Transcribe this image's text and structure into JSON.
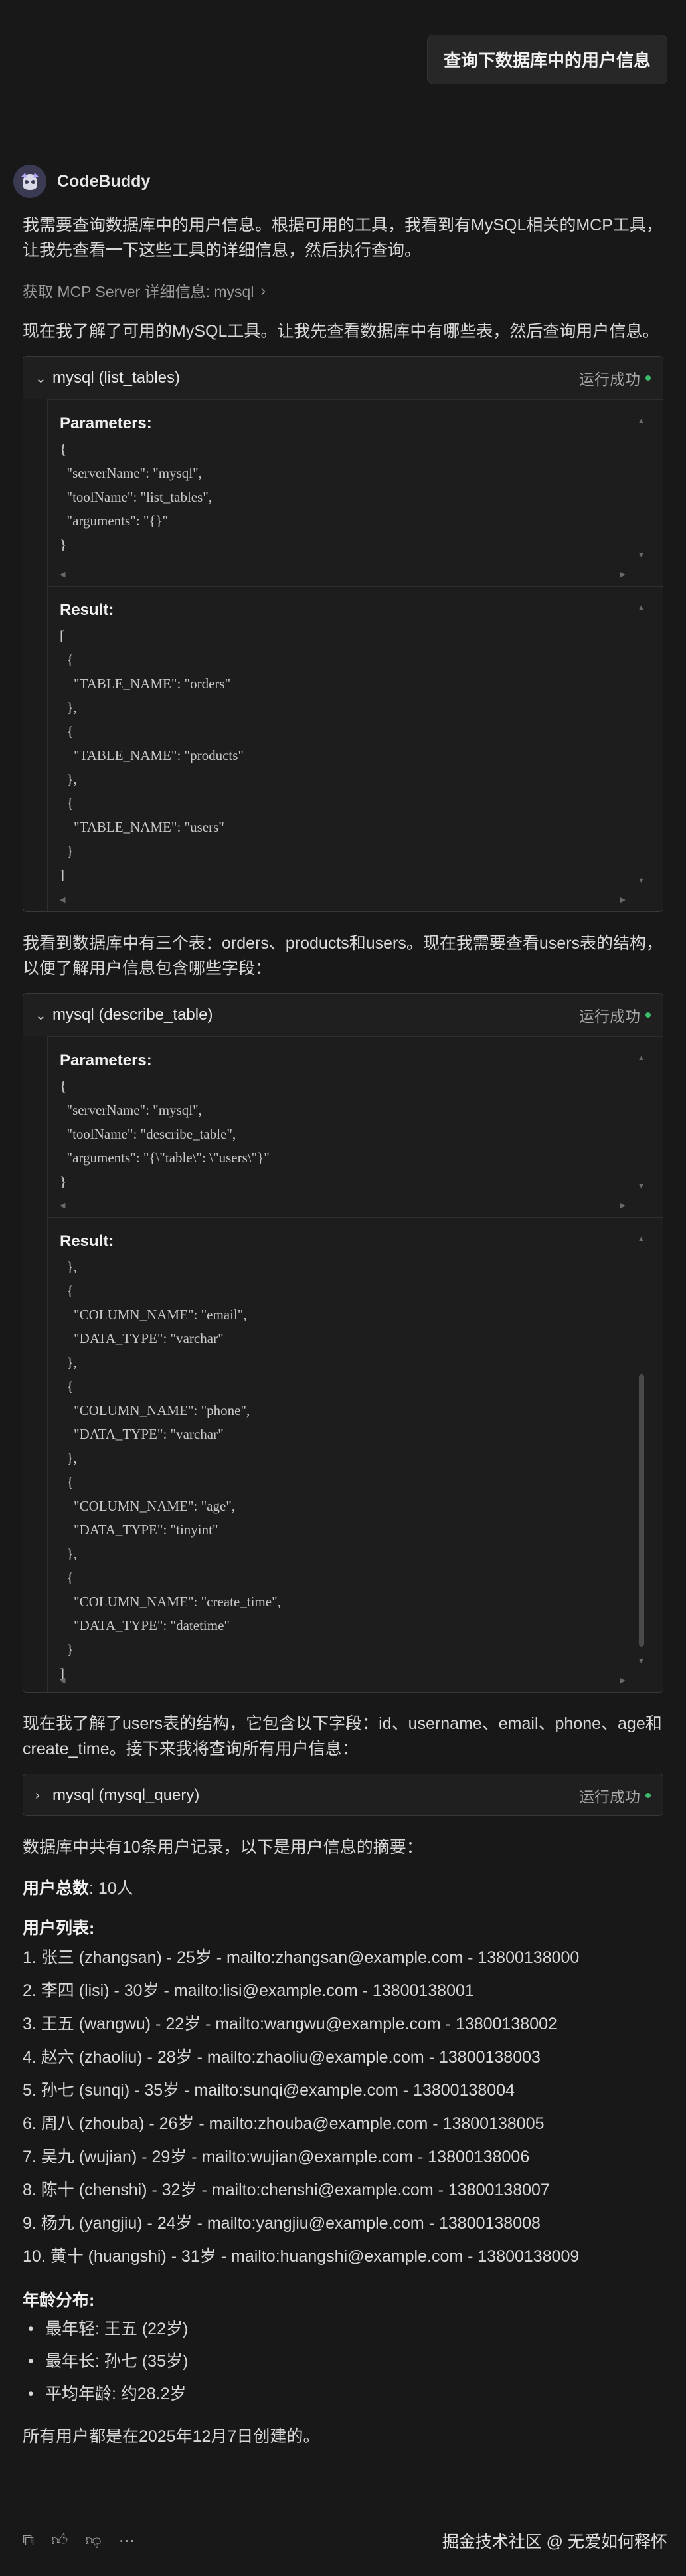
{
  "user_message": "查询下数据库中的用户信息",
  "agent": {
    "name": "CodeBuddy"
  },
  "intro": "我需要查询数据库中的用户信息。根据可用的工具，我看到有MySQL相关的MCP工具，让我先查看一下这些工具的详细信息，然后执行查询。",
  "mcp_link": "获取 MCP Server 详细信息: mysql",
  "para_after_mcp": "现在我了解了可用的MySQL工具。让我先查看数据库中有哪些表，然后查询用户信息。",
  "tool1": {
    "title": "mysql (list_tables)",
    "status": "运行成功",
    "params_label": "Parameters:",
    "params_code": "{\n  \"serverName\": \"mysql\",\n  \"toolName\": \"list_tables\",\n  \"arguments\": \"{}\"\n}",
    "result_label": "Result:",
    "result_code": "[\n  {\n    \"TABLE_NAME\": \"orders\"\n  },\n  {\n    \"TABLE_NAME\": \"products\"\n  },\n  {\n    \"TABLE_NAME\": \"users\"\n  }\n]"
  },
  "para_tables": "我看到数据库中有三个表：orders、products和users。现在我需要查看users表的结构，以便了解用户信息包含哪些字段：",
  "tool2": {
    "title": "mysql (describe_table)",
    "status": "运行成功",
    "params_label": "Parameters:",
    "params_code": "{\n  \"serverName\": \"mysql\",\n  \"toolName\": \"describe_table\",\n  \"arguments\": \"{\\\"table\\\": \\\"users\\\"}\"\n}",
    "result_label": "Result:",
    "result_code": "  },\n  {\n    \"COLUMN_NAME\": \"email\",\n    \"DATA_TYPE\": \"varchar\"\n  },\n  {\n    \"COLUMN_NAME\": \"phone\",\n    \"DATA_TYPE\": \"varchar\"\n  },\n  {\n    \"COLUMN_NAME\": \"age\",\n    \"DATA_TYPE\": \"tinyint\"\n  },\n  {\n    \"COLUMN_NAME\": \"create_time\",\n    \"DATA_TYPE\": \"datetime\"\n  }\n]"
  },
  "para_structure": "现在我了解了users表的结构，它包含以下字段：id、username、email、phone、age和create_time。接下来我将查询所有用户信息：",
  "tool3": {
    "title": "mysql (mysql_query)",
    "status": "运行成功"
  },
  "summary_intro": "数据库中共有10条用户记录，以下是用户信息的摘要：",
  "total_label": "用户总数",
  "total_value": ": 10人",
  "list_label": "用户列表",
  "list_colon": ":",
  "users": [
    "1. 张三 (zhangsan) - 25岁 - mailto:zhangsan@example.com - 13800138000",
    "2. 李四 (lisi) - 30岁 - mailto:lisi@example.com - 13800138001",
    "3. 王五 (wangwu) - 22岁 - mailto:wangwu@example.com - 13800138002",
    "4. 赵六 (zhaoliu) - 28岁 - mailto:zhaoliu@example.com - 13800138003",
    "5. 孙七 (sunqi) - 35岁 - mailto:sunqi@example.com - 13800138004",
    "6. 周八 (zhouba) - 26岁 - mailto:zhouba@example.com - 13800138005",
    "7. 吴九 (wujian) - 29岁 - mailto:wujian@example.com - 13800138006",
    "8. 陈十 (chenshi) - 32岁 - mailto:chenshi@example.com - 13800138007",
    "9. 杨九 (yangjiu) - 24岁 - mailto:yangjiu@example.com - 13800138008",
    "10. 黄十 (huangshi) - 31岁 - mailto:huangshi@example.com - 13800138009"
  ],
  "age_label": "年龄分布",
  "age_colon": ":",
  "age_items": [
    "最年轻: 王五 (22岁)",
    "最年长: 孙七 (35岁)",
    "平均年龄: 约28.2岁"
  ],
  "closing": "所有用户都是在2025年12月7日创建的。",
  "watermark": "掘金技术社区 @ 无爱如何释怀",
  "colors": {
    "background": "#181818",
    "success_dot": "#3cba6a",
    "panel": "#1d1d1d"
  },
  "icons": [
    "copy-icon",
    "thumbs-up-icon",
    "thumbs-down-icon",
    "more-icon",
    "chevron-down-icon",
    "chevron-right-icon"
  ]
}
